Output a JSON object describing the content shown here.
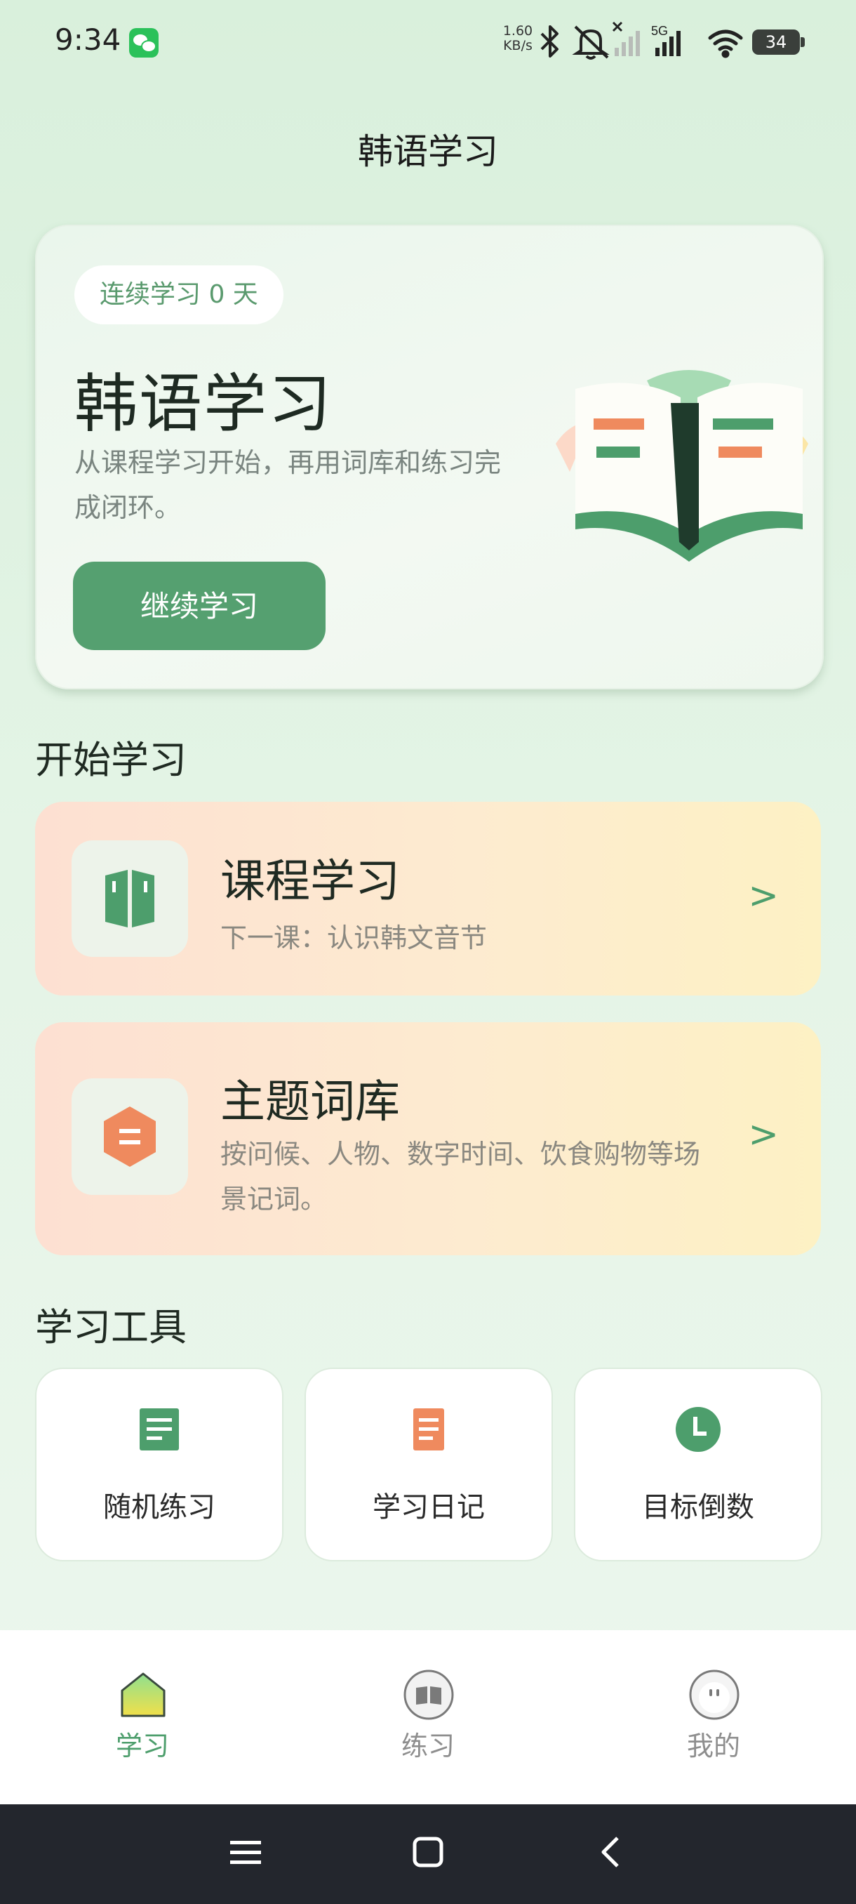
{
  "status_bar": {
    "time": "9:34",
    "net_speed_value": "1.60",
    "net_speed_unit": "KB/s",
    "network_type": "5G",
    "battery": "34",
    "icons": [
      "wechat-icon",
      "bluetooth-icon",
      "mute-icon",
      "no-signal-icon",
      "signal-icon",
      "wifi-icon",
      "battery-icon"
    ]
  },
  "header": {
    "title": "韩语学习"
  },
  "hero": {
    "streak": "连续学习 0 天",
    "title": "韩语学习",
    "description": "从课程学习开始，再用词库和练习完成闭环。",
    "button": "继续学习"
  },
  "start_section": {
    "title": "开始学习",
    "cards": [
      {
        "title": "课程学习",
        "subtitle": "下一课：认识韩文音节",
        "arrow": ">",
        "icon": "book-icon"
      },
      {
        "title": "主题词库",
        "subtitle": "按问候、人物、数字时间、饮食购物等场景记词。",
        "arrow": ">",
        "icon": "hexagon-list-icon"
      }
    ]
  },
  "tools_section": {
    "title": "学习工具",
    "items": [
      {
        "label": "随机练习",
        "icon": "document-icon",
        "color": "#4d9e6c"
      },
      {
        "label": "学习日记",
        "icon": "diary-icon",
        "color": "#ef8a5e"
      },
      {
        "label": "目标倒数",
        "icon": "clock-icon",
        "color": "#4d9e6c"
      }
    ]
  },
  "tab_bar": {
    "tabs": [
      {
        "label": "学习",
        "icon": "home-icon",
        "active": true
      },
      {
        "label": "练习",
        "icon": "book-circle-icon",
        "active": false
      },
      {
        "label": "我的",
        "icon": "profile-circle-icon",
        "active": false
      }
    ]
  },
  "colors": {
    "accent": "#4d9e6c",
    "button": "#55a070",
    "orange": "#ef8a5e",
    "nav_bar": "#23262d"
  }
}
